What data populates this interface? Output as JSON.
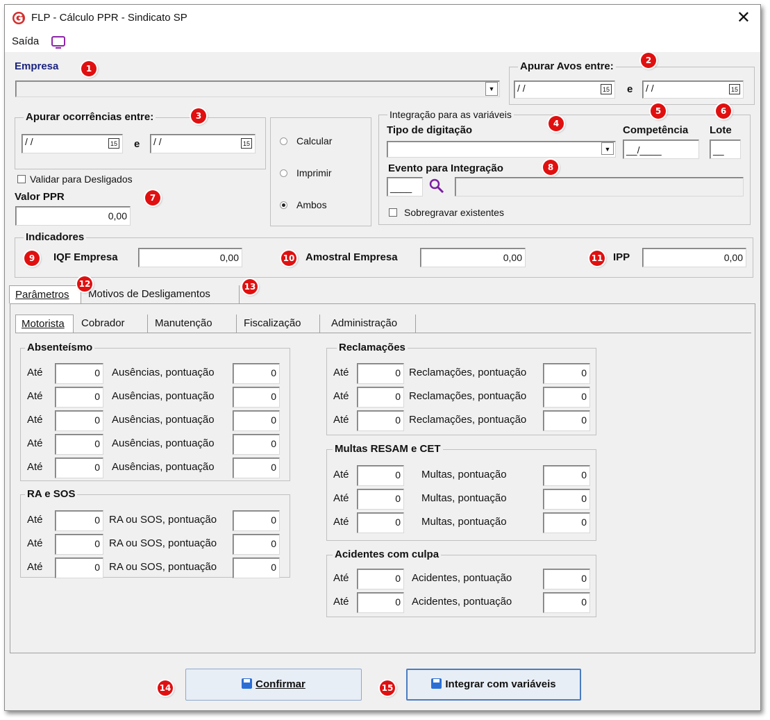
{
  "window": {
    "title": "FLP - Cálculo PPR - Sindicato SP",
    "close_glyph": "✕"
  },
  "menu": {
    "saida_label": "Saída"
  },
  "empresa": {
    "label": "Empresa",
    "value": ""
  },
  "avos": {
    "label": "Apurar Avos entre:",
    "from": " / /",
    "to": " / /",
    "sep": "e"
  },
  "ocorrencias": {
    "label": "Apurar ocorrências entre:",
    "from": " / /",
    "to": " / /",
    "sep": "e"
  },
  "validar": {
    "label": "Validar para Desligados",
    "checked": false
  },
  "valor_ppr": {
    "label": "Valor PPR",
    "value": "0,00"
  },
  "modo": {
    "options": [
      "Calcular",
      "Imprimir",
      "Ambos"
    ],
    "selected": "Ambos"
  },
  "integracao": {
    "group_label": "Integração para as variáveis",
    "tipo_label": "Tipo de digitação",
    "competencia_label": "Competência",
    "competencia_value": "__/____",
    "lote_label": "Lote",
    "lote_value": "__",
    "evento_label": "Evento para Integração",
    "evento_value": "____",
    "sobregravar_label": "Sobregravar existentes"
  },
  "indicadores": {
    "label": "Indicadores",
    "iqf_label": "IQF Empresa",
    "iqf_value": "0,00",
    "amostral_label": "Amostral Empresa",
    "amostral_value": "0,00",
    "ipp_label": "IPP",
    "ipp_value": "0,00"
  },
  "tabs": [
    "Parâmetros",
    "Motivos de Desligamentos"
  ],
  "subtabs": [
    "Motorista",
    "Cobrador",
    "Manutenção",
    "Fiscalização",
    "Administração"
  ],
  "absenteismo": {
    "label": "Absenteísmo",
    "row_prefix": "Até",
    "row_label": "Ausências, pontuação",
    "rows": [
      [
        "0",
        "0"
      ],
      [
        "0",
        "0"
      ],
      [
        "0",
        "0"
      ],
      [
        "0",
        "0"
      ],
      [
        "0",
        "0"
      ]
    ]
  },
  "ra_sos": {
    "label": "RA e SOS",
    "row_prefix": "Até",
    "row_label": "RA ou SOS, pontuação",
    "rows": [
      [
        "0",
        "0"
      ],
      [
        "0",
        "0"
      ],
      [
        "0",
        "0"
      ]
    ]
  },
  "reclamacoes": {
    "label": "Reclamações",
    "row_prefix": "Até",
    "row_label": "Reclamações, pontuação",
    "rows": [
      [
        "0",
        "0"
      ],
      [
        "0",
        "0"
      ],
      [
        "0",
        "0"
      ]
    ]
  },
  "multas": {
    "label": "Multas RESAM e CET",
    "row_prefix": "Até",
    "row_label": "Multas, pontuação",
    "rows": [
      [
        "0",
        "0"
      ],
      [
        "0",
        "0"
      ],
      [
        "0",
        "0"
      ]
    ]
  },
  "acidentes": {
    "label": "Acidentes com culpa",
    "row_prefix": "Até",
    "row_label": "Acidentes, pontuação",
    "rows": [
      [
        "0",
        "0"
      ],
      [
        "0",
        "0"
      ]
    ]
  },
  "buttons": {
    "confirmar": "Confirmar",
    "integrar": "Integrar com variáveis"
  },
  "badges": [
    "1",
    "2",
    "3",
    "4",
    "5",
    "6",
    "7",
    "8",
    "9",
    "10",
    "11",
    "12",
    "13",
    "14",
    "15"
  ],
  "colors": {
    "badge": "#e01010",
    "label_blue": "#1a237e",
    "accent": "#2b6fd6",
    "brand": "#d32f2f"
  }
}
